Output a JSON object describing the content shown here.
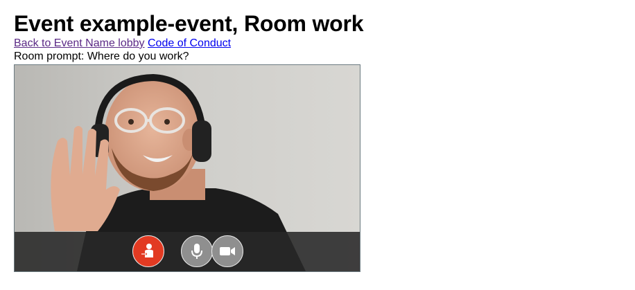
{
  "page": {
    "title": "Event example-event, Room work"
  },
  "links": {
    "lobby_label": "Back to Event Name lobby",
    "conduct_label": "Code of Conduct"
  },
  "room": {
    "prompt": "Room prompt: Where do you work?"
  },
  "video": {
    "participant": "self-view",
    "controls": [
      {
        "name": "leave-room",
        "icon": "person-exit-icon",
        "color": "#e23a22"
      },
      {
        "name": "microphone",
        "icon": "microphone-icon",
        "color": "#8f8f8f"
      },
      {
        "name": "camera",
        "icon": "video-camera-icon",
        "color": "#8f8f8f"
      }
    ]
  },
  "colors": {
    "visited_link": "#5b2a86",
    "link": "#0000ee",
    "controls_bar": "#282828"
  }
}
